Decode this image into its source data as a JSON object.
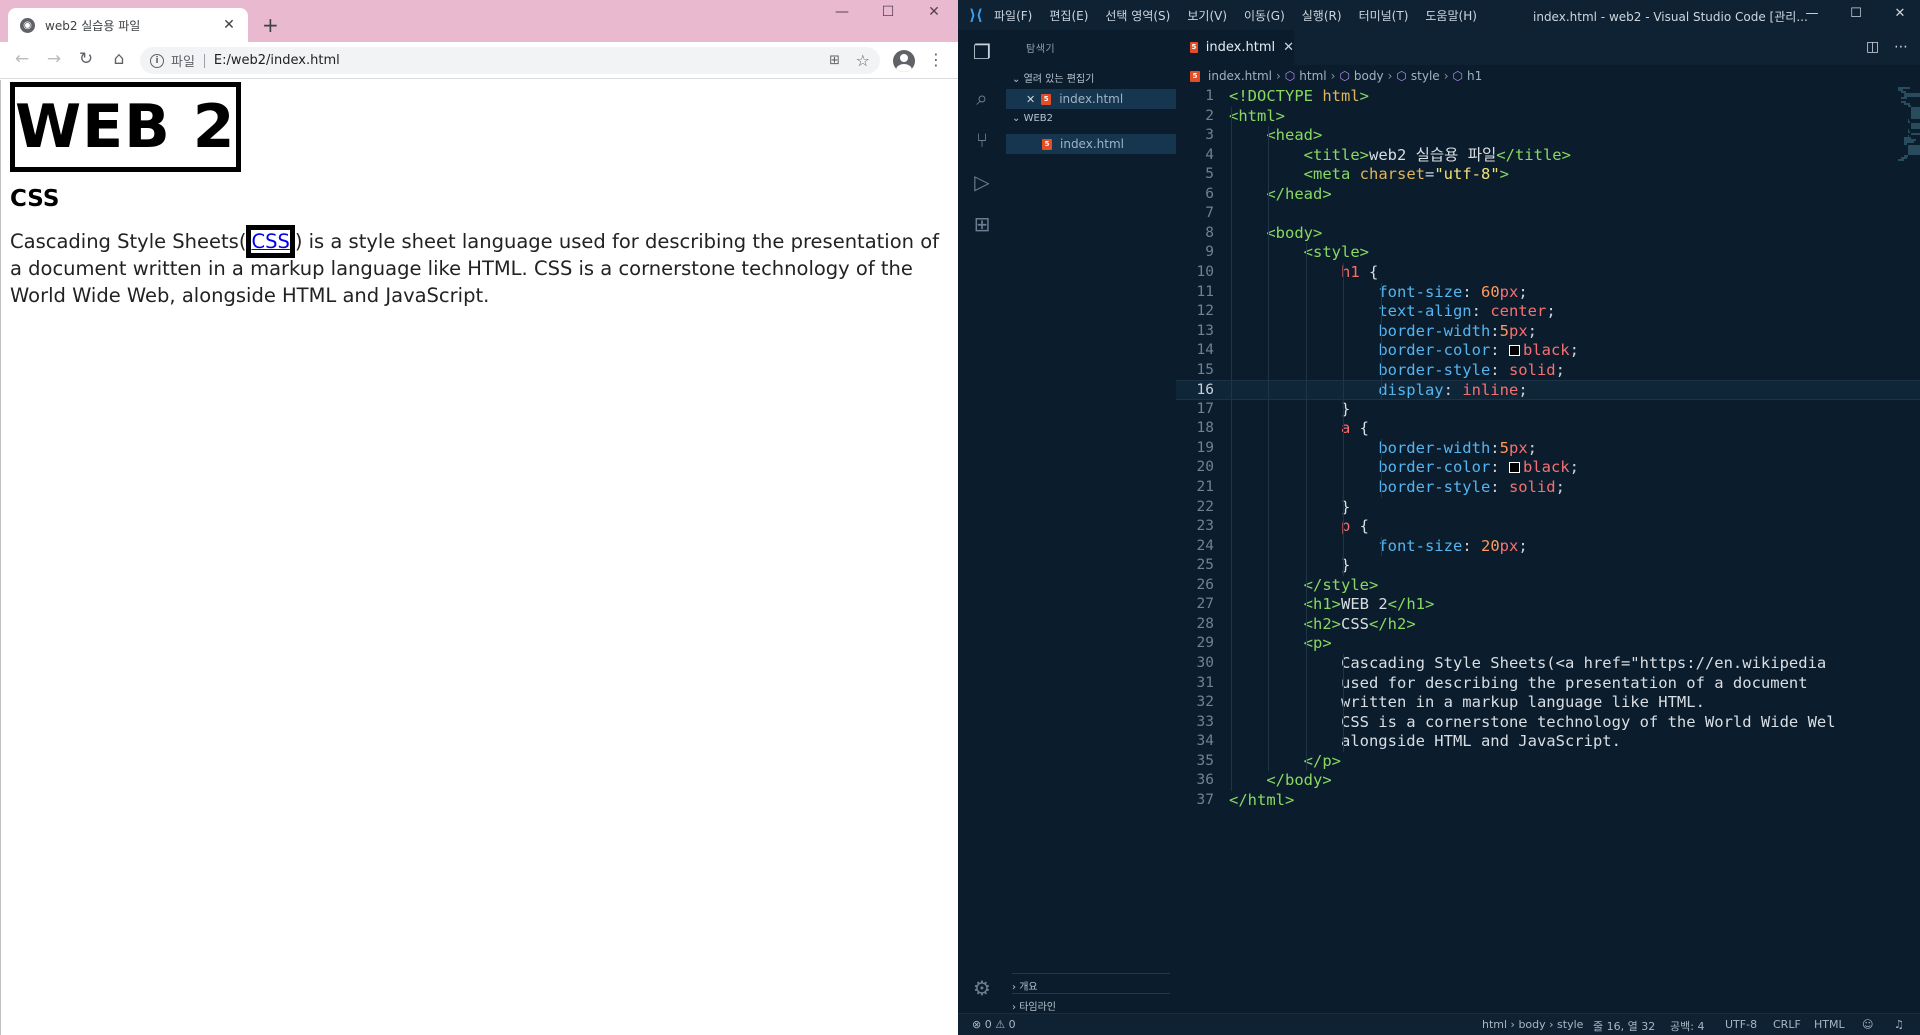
{
  "browser": {
    "tab_title": "web2 실습용 파일",
    "new_tab": "+",
    "address_scheme": "파일",
    "address_url": "E:/web2/index.html",
    "page": {
      "h1": "WEB 2",
      "h2": "CSS",
      "p_before": "Cascading Style Sheets(",
      "p_link": "CSS",
      "p_after": ") is a style sheet language used for describing the presentation of a document written in a markup language like HTML. CSS is a cornerstone technology of the World Wide Web, alongside HTML and JavaScript."
    }
  },
  "vscode": {
    "menu": [
      "파일(F)",
      "편집(E)",
      "선택 영역(S)",
      "보기(V)",
      "이동(G)",
      "실행(R)",
      "터미널(T)",
      "도움말(H)"
    ],
    "window_title": "index.html - web2 - Visual Studio Code [관리...",
    "sidebar": {
      "title": "탐색기",
      "open_editors_label": "열려 있는 편집기",
      "open_editor_file": "index.html",
      "folder_label": "WEB2",
      "folder_file": "index.html",
      "outline_label": "개요",
      "timeline_label": "타임라인"
    },
    "editor_tab": "index.html",
    "breadcrumb": [
      "index.html",
      "html",
      "body",
      "style",
      "h1"
    ],
    "code_lines": [
      "<!DOCTYPE html>",
      "<html>",
      "    <head>",
      "        <title>web2 실습용 파일</title>",
      "        <meta charset=\"utf-8\">",
      "    </head>",
      "",
      "    <body>",
      "        <style>",
      "            h1 {",
      "                font-size: 60px;",
      "                text-align: center;",
      "                border-width:5px;",
      "                border-color: black;",
      "                border-style: solid;",
      "                display: inline;",
      "            }",
      "            a {",
      "                border-width:5px;",
      "                border-color: black;",
      "                border-style: solid;",
      "            }",
      "            p {",
      "                font-size: 20px;",
      "            }",
      "        </style>",
      "        <h1>WEB 2</h1>",
      "        <h2>CSS</h2>",
      "        <p>",
      "            Cascading Style Sheets(<a href=\"https://en.wikipedia",
      "            used for describing the presentation of a document",
      "            written in a markup language like HTML.",
      "            CSS is a cornerstone technology of the World Wide Wel",
      "            alongside HTML and JavaScript.",
      "        </p>",
      "    </body>",
      "</html>"
    ],
    "current_line": 16,
    "status": {
      "problems": "⊗ 0 ⚠ 0",
      "path": "html › body › style",
      "position": "줄 16, 열 32",
      "spaces": "공백: 4",
      "encoding": "UTF-8",
      "eol": "CRLF",
      "language": "HTML"
    }
  }
}
